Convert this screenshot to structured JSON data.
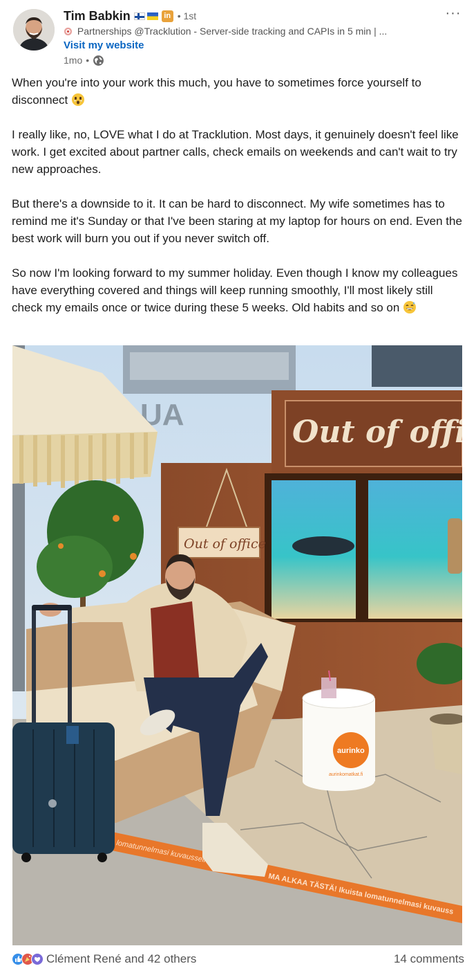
{
  "post": {
    "author": {
      "name": "Tim Babkin",
      "linkedin_badge": "in",
      "connection_degree": "1st",
      "headline": "Partnerships @Tracklution - Server-side tracking and CAPIs in 5 min | ...",
      "website_link": "Visit my website",
      "timestamp": "1mo",
      "separator": "•",
      "visibility_icon": "globe-icon",
      "flags": [
        "finland-flag",
        "ukraine-flag"
      ]
    },
    "more_menu": "···",
    "paragraphs": [
      "When you're into your work this much, you have to sometimes force yourself to disconnect",
      "I really like, no, LOVE what I do at Tracklution. Most days, it genuinely doesn't feel like work. I get excited about partner calls, check emails on weekends and can't wait to try new approaches.",
      "But there's a downside to it. It can be hard to disconnect. My wife sometimes has to remind me it's Sunday or that I've been staring at my laptop for hours on end. Even the best work will burn you out if you never switch off.",
      "So now I'm looking forward to my summer holiday. Even though I know my colleagues have everything covered and things will keep running smoothly, I'll most likely still check my emails once or twice during these 5 weeks. Old habits and so on"
    ],
    "image": {
      "sign_large": "Out of office",
      "sign_small": "Out of office",
      "table_brand": "aurinko",
      "table_url": "aurinkomatkat.fi",
      "floor_text_1": "lomatunnelmasi kuvausseinällä",
      "floor_text_2": "MA ALKAA TÄSTÄ! Ikuista lomatunnelmasi kuvauss",
      "window_letters": "UA"
    },
    "social": {
      "reactions_text": "Clément René and 42 others",
      "comments_text": "14 comments",
      "reaction_icons": [
        "like-icon",
        "celebrate-icon",
        "love-icon"
      ]
    }
  },
  "colors": {
    "link": "#0a66c2",
    "text": "#1d1d1d",
    "muted": "#6b6b6b",
    "linkedin_badge": "#e9a23b"
  }
}
